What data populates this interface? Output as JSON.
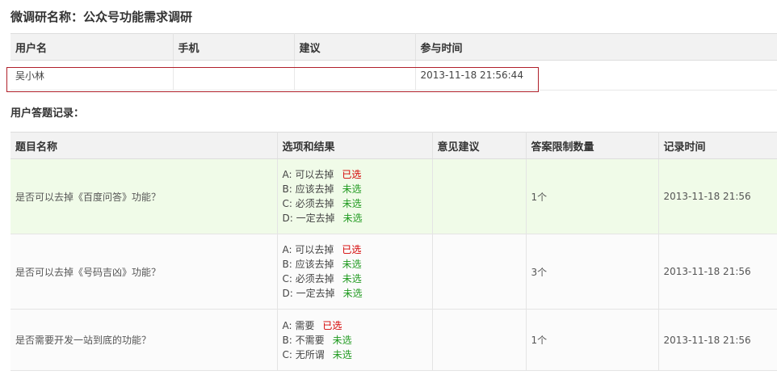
{
  "survey": {
    "title": "微调研名称：公众号功能需求调研"
  },
  "user_table": {
    "headers": [
      "用户名",
      "手机",
      "建议",
      "参与时间"
    ],
    "row": {
      "username": "吴小林",
      "phone": "",
      "suggestion": "",
      "time": "2013-11-18 21:56:44"
    }
  },
  "answers": {
    "section_label": "用户答题记录：",
    "headers": [
      "题目名称",
      "选项和结果",
      "意见建议",
      "答案限制数量",
      "记录时间"
    ],
    "rows": [
      {
        "question": "是否可以去掉《百度问答》功能？",
        "options": [
          {
            "label": "A: 可以去掉",
            "status": "已选",
            "selected": true
          },
          {
            "label": "B: 应该去掉",
            "status": "未选",
            "selected": false
          },
          {
            "label": "C: 必须去掉",
            "status": "未选",
            "selected": false
          },
          {
            "label": "D: 一定去掉",
            "status": "未选",
            "selected": false
          }
        ],
        "comment": "",
        "limit": "1个",
        "time": "2013-11-18 21:56"
      },
      {
        "question": "是否可以去掉《号码吉凶》功能？",
        "options": [
          {
            "label": "A: 可以去掉",
            "status": "已选",
            "selected": true
          },
          {
            "label": "B: 应该去掉",
            "status": "未选",
            "selected": false
          },
          {
            "label": "C: 必须去掉",
            "status": "未选",
            "selected": false
          },
          {
            "label": "D: 一定去掉",
            "status": "未选",
            "selected": false
          }
        ],
        "comment": "",
        "limit": "3个",
        "time": "2013-11-18 21:56"
      },
      {
        "question": "是否需要开发一站到底的功能？",
        "options": [
          {
            "label": "A: 需要",
            "status": "已选",
            "selected": true
          },
          {
            "label": "B: 不需要",
            "status": "未选",
            "selected": false
          },
          {
            "label": "C: 无所谓",
            "status": "未选",
            "selected": false
          }
        ],
        "comment": "",
        "limit": "1个",
        "time": "2013-11-18 21:56"
      }
    ]
  },
  "colors": {
    "selected": "#d40000",
    "unselected": "#1f9a1f",
    "highlight_border": "#b0202a",
    "header_bg": "#f2f2f2",
    "first_row_bg": "#f0fbe8"
  }
}
